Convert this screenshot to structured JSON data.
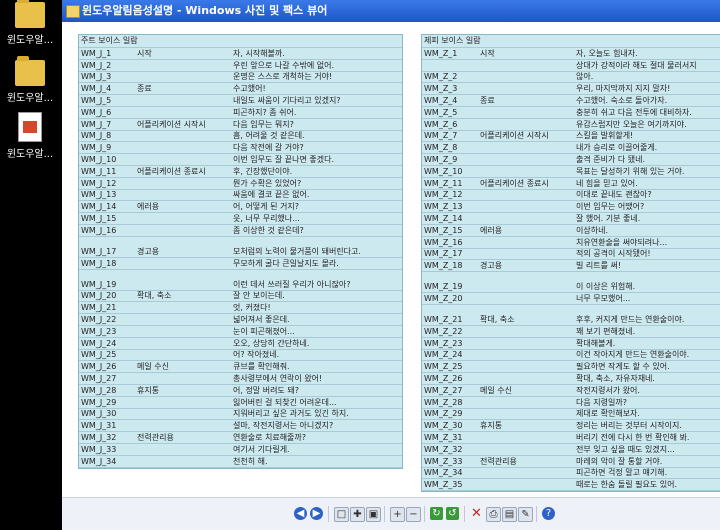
{
  "desktop": {
    "icons": [
      {
        "label": "윈도우알..."
      },
      {
        "label": "윈도우알..."
      },
      {
        "label": "윈도우알..."
      }
    ]
  },
  "window": {
    "title": "윈도우알림음성설명 - Windows 사진 및 팩스 뷰어"
  },
  "left_panel": {
    "header": "주트 보이스 일람",
    "rows": [
      [
        "WM_J_1",
        "시작",
        "자, 시작해볼까."
      ],
      [
        "WM_J_2",
        "",
        "우린 앞으로 나갈 수밖에 없어."
      ],
      [
        "WM_J_3",
        "",
        "운명은 스스로 개척하는 거야!"
      ],
      [
        "WM_J_4",
        "종료",
        "수고했어!"
      ],
      [
        "WM_J_5",
        "",
        "내일도 싸움이 기다리고 있겠지?"
      ],
      [
        "WM_J_6",
        "",
        "피곤하지? 좀 쉬어."
      ],
      [
        "WM_J_7",
        "어플리케이션 시작시",
        "다음 임무는 뭐지?"
      ],
      [
        "WM_J_8",
        "",
        "흠, 어려울 것 같은데."
      ],
      [
        "WM_J_9",
        "",
        "다음 작전에 갈 거야?"
      ],
      [
        "WM_J_10",
        "",
        "이번 임무도 잘 끝나면 좋겠다."
      ],
      [
        "WM_J_11",
        "어플리케이션 종료시",
        "후, 긴장했단이야."
      ],
      [
        "WM_J_12",
        "",
        "뭔가 수확은 있었어?"
      ],
      [
        "WM_J_13",
        "",
        "싸움에 결코 끝은 없어."
      ],
      [
        "WM_J_14",
        "에러용",
        "어, 어떻게 된 거지?"
      ],
      [
        "WM_J_15",
        "",
        "읏, 너무 무리했나..."
      ],
      [
        "WM_J_16",
        "",
        "좀 이상한 것 같은데?"
      ],
      [
        "WM_J_17",
        "경고용",
        "모처럼의 노력이 물거품이 돼버린다고."
      ],
      [
        "WM_J_18",
        "",
        "무모하게 굴다 큰일날지도 몰라."
      ],
      [
        "WM_J_19",
        "",
        "이런 데서 쓰러질 우리가 아니잖아?"
      ],
      [
        "WM_J_20",
        "확대, 축소",
        "잘 안 보이는데."
      ],
      [
        "WM_J_21",
        "",
        "엇, 커졌다!"
      ],
      [
        "WM_J_22",
        "",
        "넓어져서 좋은데."
      ],
      [
        "WM_J_23",
        "",
        "눈이 피곤해졌어..."
      ],
      [
        "WM_J_24",
        "",
        "오오, 상당히 간단하네."
      ],
      [
        "WM_J_25",
        "",
        "어? 작아졌네."
      ],
      [
        "WM_J_26",
        "메일 수신",
        "큐브를 확인해줘."
      ],
      [
        "WM_J_27",
        "",
        "총사령부에서 연락이 왔어!"
      ],
      [
        "WM_J_28",
        "휴지통",
        "어, 정말 버려도 돼?"
      ],
      [
        "WM_J_29",
        "",
        "잃어버린 걸 되찾긴 어려운데..."
      ],
      [
        "WM_J_30",
        "",
        "지워버리고 싶은 과거도 있긴 하지."
      ],
      [
        "WM_J_31",
        "",
        "설마, 작전지령서는 아니겠지?"
      ],
      [
        "WM_J_32",
        "전력관리용",
        "연환술로 치료해줄까?"
      ],
      [
        "WM_J_33",
        "",
        "여기서 기다릴게."
      ],
      [
        "WM_J_34",
        "",
        "천천히 해."
      ]
    ]
  },
  "right_panel": {
    "header": "제피 보이스 일람",
    "rows": [
      [
        "WM_Z_1",
        "시작",
        "자, 오늘도 힘내자."
      ],
      [
        "",
        "",
        "상대가 강적이라 해도 절대 물러서지"
      ],
      [
        "WM_Z_2",
        "",
        "않아."
      ],
      [
        "WM_Z_3",
        "",
        "우리, 마지막까지 지지 말자!"
      ],
      [
        "WM_Z_4",
        "종료",
        "수고했어. 숙소로 돌아가자."
      ],
      [
        "WM_Z_5",
        "",
        "충분히 쉬고 다음 전투에 대비하자."
      ],
      [
        "WM_Z_6",
        "",
        "유감스럽지만 오늘은 여기까지야."
      ],
      [
        "WM_Z_7",
        "어플리케이션 시작시",
        "스킬을 발휘할게!"
      ],
      [
        "WM_Z_8",
        "",
        "내가 승리로 이끌어줄게."
      ],
      [
        "WM_Z_9",
        "",
        "출격 준비가 다 됐네."
      ],
      [
        "WM_Z_10",
        "",
        "목표는 달성하기 위해 있는 거야."
      ],
      [
        "WM_Z_11",
        "어플리케이션 종료시",
        "네 힘을 믿고 있어."
      ],
      [
        "WM_Z_12",
        "",
        "이대로 끝내도 괜찮아?"
      ],
      [
        "WM_Z_13",
        "",
        "이번 임무는 어땠어?"
      ],
      [
        "WM_Z_14",
        "",
        "잘 했어. 기분 좋네."
      ],
      [
        "WM_Z_15",
        "에러용",
        "이상하네."
      ],
      [
        "WM_Z_16",
        "",
        "치유연환술을 써야되려나..."
      ],
      [
        "WM_Z_17",
        "",
        "적의 공격이 시작됐어!"
      ],
      [
        "WM_Z_18",
        "경고용",
        "빌 리트를 써!"
      ],
      [
        "WM_Z_19",
        "",
        "이 이상은 위험해."
      ],
      [
        "WM_Z_20",
        "",
        "너무 무모했어..."
      ],
      [
        "WM_Z_21",
        "확대, 축소",
        "후후, 커지게 만드는 연환술이야."
      ],
      [
        "WM_Z_22",
        "",
        "꽤 보기 편해졌네."
      ],
      [
        "WM_Z_23",
        "",
        "확대해볼게."
      ],
      [
        "WM_Z_24",
        "",
        "이건 작아지게 만드는 연환술이야."
      ],
      [
        "WM_Z_25",
        "",
        "필요하면 작게도 할 수 있어."
      ],
      [
        "WM_Z_26",
        "",
        "확대, 축소, 자유자재네."
      ],
      [
        "WM_Z_27",
        "메일 수신",
        "작전지령서가 왔어."
      ],
      [
        "WM_Z_28",
        "",
        "다음 지령일까?"
      ],
      [
        "WM_Z_29",
        "",
        "제대로 확인해보자."
      ],
      [
        "WM_Z_30",
        "휴지통",
        "정리는 버리는 것부터 시작이지."
      ],
      [
        "WM_Z_31",
        "",
        "버리기 전에 다시 한 번 확인해 봐."
      ],
      [
        "WM_Z_32",
        "",
        "전부 잊고 싶을 때도 있겠지..."
      ],
      [
        "WM_Z_33",
        "전력관리용",
        "마레의 악이 잘 통할 거야."
      ],
      [
        "WM_Z_34",
        "",
        "피곤하면 걱정 말고 얘기해."
      ],
      [
        "WM_Z_35",
        "",
        "때로는 한숨 돌릴 필요도 있어."
      ]
    ]
  },
  "toolbar": {
    "buttons": [
      "previous-image",
      "next-image",
      "best-fit",
      "actual-size",
      "slideshow",
      "zoom-in",
      "zoom-out",
      "rotate-clockwise",
      "rotate-counterclockwise",
      "delete",
      "print",
      "copy-to",
      "open-for-editing",
      "help"
    ]
  }
}
